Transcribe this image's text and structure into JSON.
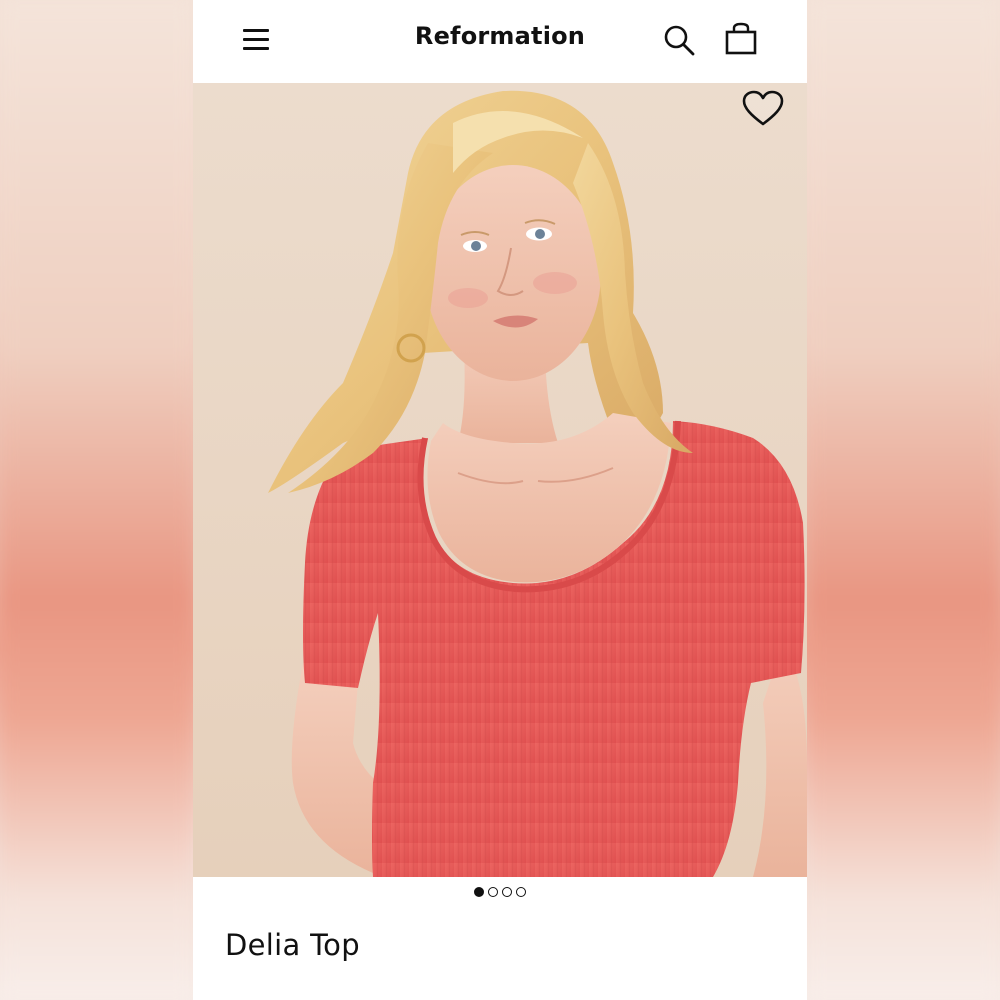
{
  "header": {
    "brand": "Reformation",
    "menu_icon": "hamburger-menu-icon",
    "search_icon": "search-icon",
    "bag_icon": "shopping-bag-icon"
  },
  "product": {
    "title": "Delia Top",
    "favorite_icon": "heart-outline-icon",
    "image_description_color": "#e85a58",
    "carousel": {
      "total": 4,
      "active": 1
    }
  },
  "colors": {
    "top_color": "#e85a58",
    "background": "#ebd9c8",
    "text": "#111111"
  }
}
